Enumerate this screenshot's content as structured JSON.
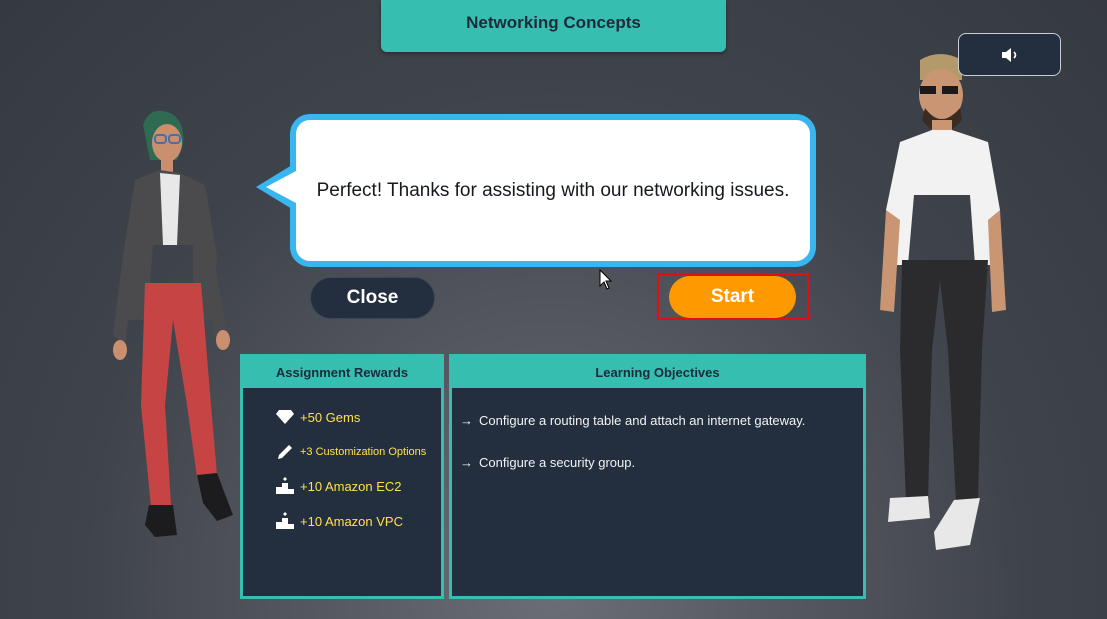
{
  "header": {
    "title": "Networking Concepts"
  },
  "sound": {
    "icon": "speaker-icon"
  },
  "dialog": {
    "message": "Perfect! Thanks for assisting with our networking issues.",
    "close_label": "Close",
    "start_label": "Start"
  },
  "rewards": {
    "title": "Assignment Rewards",
    "items": [
      {
        "icon": "gem-icon",
        "text": "+50 Gems"
      },
      {
        "icon": "pencil-icon",
        "text": "+3 Customization Options"
      },
      {
        "icon": "podium-icon",
        "text": "+10 Amazon EC2"
      },
      {
        "icon": "podium-icon",
        "text": "+10 Amazon VPC"
      }
    ]
  },
  "objectives": {
    "title": "Learning Objectives",
    "arrow": "→",
    "items": [
      "Configure a routing table and attach an internet gateway.",
      "Configure a security group."
    ]
  },
  "colors": {
    "accent": "#36bfb1",
    "bubble_border": "#38b6f0",
    "start": "#ff9900",
    "panel_bg": "#232f3e",
    "reward_text": "#ffe14d"
  }
}
